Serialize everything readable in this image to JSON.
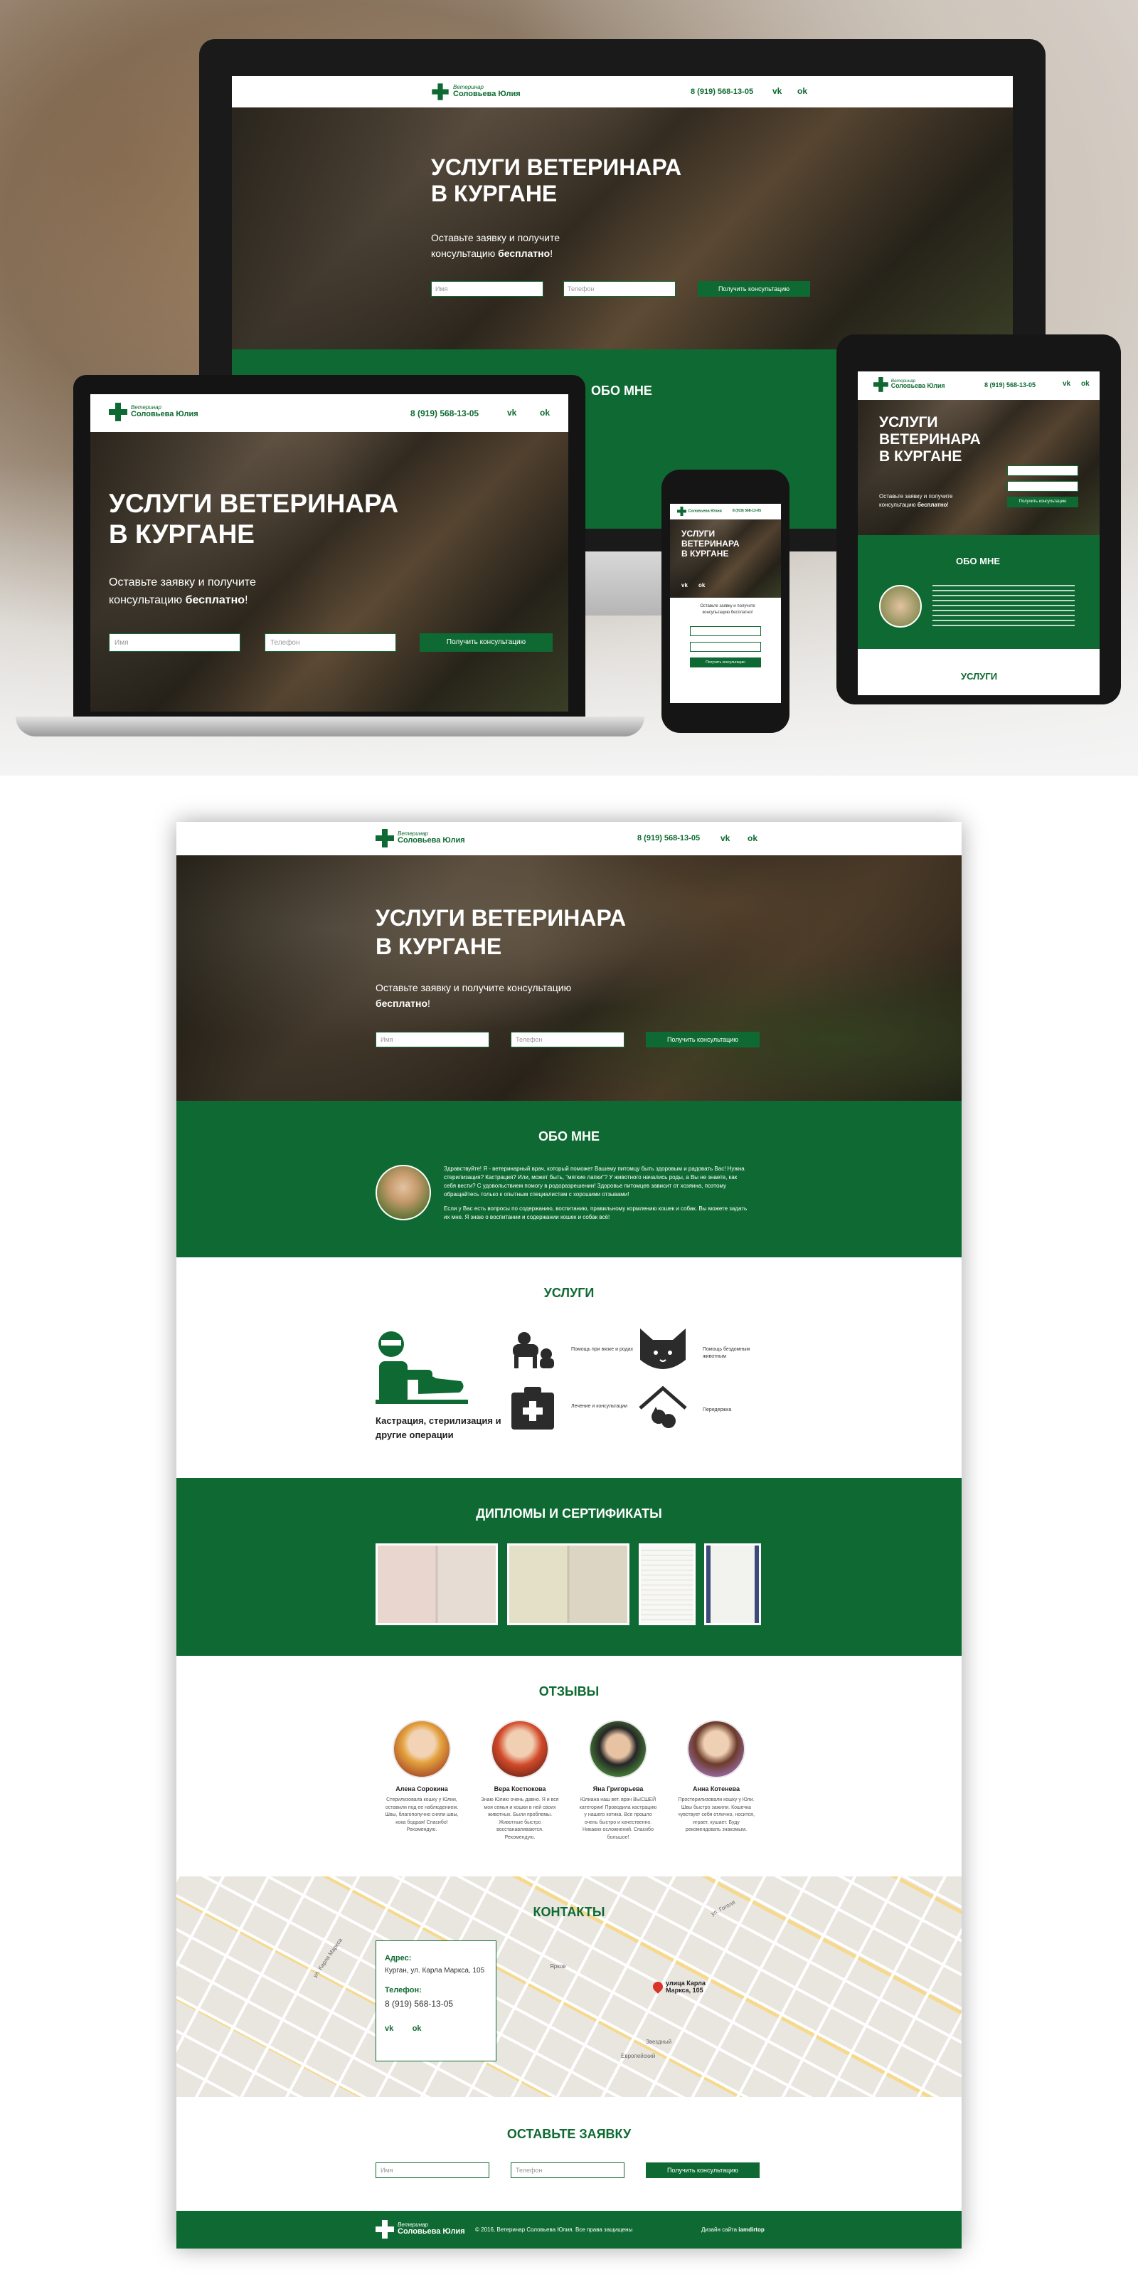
{
  "brand": {
    "logo_line1": "Ветеринар",
    "logo_line2": "Соловьева Юлия"
  },
  "header": {
    "phone": "8 (919) 568-13-05",
    "vk_label": "vk",
    "ok_label": "ok",
    "vk_icon": "vk-icon",
    "ok_icon": "odnoklassniki-icon"
  },
  "hero": {
    "title_line1": "УСЛУГИ ВЕТЕРИНАРА",
    "title_line2": "В КУРГАНЕ",
    "subtitle_part1": "Оставьте заявку и получите консультацию",
    "subtitle_bold": "бесплатно",
    "subtitle_end": "!",
    "name_placeholder": "Имя",
    "phone_placeholder": "Телефон",
    "submit_label": "Получить консультацию"
  },
  "about": {
    "title": "ОБО МНЕ",
    "paragraph1": "Здравствуйте! Я - ветеринарный врач, который поможет Вашему питомцу быть здоровым и радовать Вас! Нужна стерилизация? Кастрация? Или, может быть, \"мягкие лапки\"? У животного начались роды, а Вы не знаете, как себя вести? С удовольствием помогу в родоразрешении! Здоровье питомцев зависит от хозяина, поэтому обращайтесь только к опытным специалистам с хорошими отзывами!",
    "paragraph2": "Если у Вас есть вопросы по содержанию, воспитанию, правильному кормлению кошек и собак. Вы можете задать их мне. Я знаю о воспитании и содержании кошек и собак всё!"
  },
  "services": {
    "title": "УСЛУГИ",
    "main_label": "Кастрация, стерилизация и другие операции",
    "items": [
      {
        "label": "Помощь при вязке и родах",
        "icon": "dogs-icon"
      },
      {
        "label": "Помощь бездомным животным",
        "icon": "cat-face-icon"
      },
      {
        "label": "Лечение и консультации",
        "icon": "medical-kit-icon"
      },
      {
        "label": "Передержка",
        "icon": "pet-house-icon"
      }
    ]
  },
  "diplomas": {
    "title": "ДИПЛОМЫ И СЕРТИФИКАТЫ"
  },
  "reviews": {
    "title": "ОТЗЫВЫ",
    "items": [
      {
        "name": "Алена Сорокина",
        "text": "Стерилизовала кошку у Юлии, оставили под ее наблюдением. Швы, благополучно сняли швы, кока бодрая! Спасибо! Рекомендую."
      },
      {
        "name": "Вера Костюкова",
        "text": "Знаю Юлию очень давно. Я и вся моя семья и кошки в ней своих животных. Были проблемы. Животные быстро восстанавливаются. Рекомендую."
      },
      {
        "name": "Яна Григорьева",
        "text": "Юлиана наш вет. врач ВЫСШЕЙ категории! Проводила кастрацию у нашего котика. Все прошло очень быстро и качественно. Никаких осложнений. Спасибо большое!"
      },
      {
        "name": "Анна Котенева",
        "text": "Простерилизовали кошку у Юли. Швы быстро зажили. Кошечка чувствует себя отлично, носится, играет, кушает. Буду рекомендовать знакомым."
      }
    ]
  },
  "contacts": {
    "title": "КОНТАКТЫ",
    "address_heading": "Адрес:",
    "address": "Курган, ул. Карла Маркса, 105",
    "phone_heading": "Телефон:",
    "phone": "8 (919) 568-13-05",
    "map_pin_label": "улица Карла Маркса, 105",
    "map_labels": [
      "Европейский",
      "Звездный",
      "Ярков",
      "ул. Гоголя",
      "ул. Карла Маркса"
    ]
  },
  "request": {
    "title": "ОСТАВЬТЕ ЗАЯВКУ",
    "name_placeholder": "Имя",
    "phone_placeholder": "Телефон",
    "submit_label": "Получить консультацию"
  },
  "footer": {
    "copyright": "© 2016, Ветеринар Соловьева Юлия. Все права защищены",
    "design_prefix": "Дизайн сайта",
    "design_author": "iamdirtop"
  },
  "mockups": {
    "about_title": "ОБО МНЕ",
    "services_title": "УСЛУГИ",
    "phone_sub": "Оставьте заявку и получите консультацию бесплатно!"
  },
  "colors": {
    "brand_green": "#0e6a32",
    "white": "#ffffff",
    "text_dark": "#222222"
  }
}
